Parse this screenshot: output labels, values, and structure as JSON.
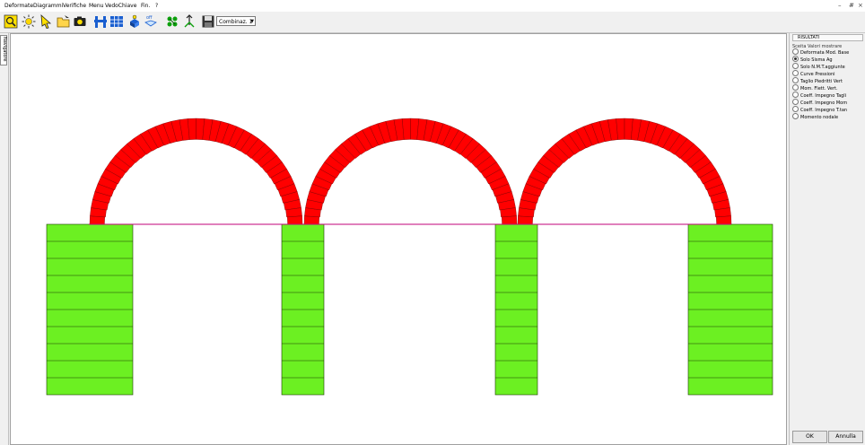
{
  "menu": {
    "items": [
      "Deformate",
      "Diagrammi",
      "Verifiche",
      "Menu",
      "VedoChiave",
      "Fin.",
      "?"
    ],
    "win_minimize": "–",
    "win_restore": "#",
    "win_close": "×"
  },
  "toolbar": {
    "icons": [
      "zoom-select-icon",
      "sun-view-icon",
      "pointer-tool-icon",
      "folder-open-icon",
      "camera-icon",
      "structure-view-icon",
      "grid-table-icon",
      "shape-3d-icon",
      "off-toggle-icon",
      "reactions-icon",
      "load-arrows-icon",
      "save-icon"
    ],
    "combo_value": "Combinaz. 1"
  },
  "left_strip": {
    "navigator_label": "Navigatore"
  },
  "right_panel": {
    "title": "RISULTATI",
    "group_label": "Sceita Valori mostrare",
    "options": [
      {
        "label": "Deformata Mod. Base",
        "selected": false
      },
      {
        "label": "Solo Sisma Ag",
        "selected": true
      },
      {
        "label": "Solo N.M.T.aggiunte",
        "selected": false
      },
      {
        "label": "Curve Pressioni",
        "selected": false
      },
      {
        "label": "Taglio Piedritti Vert",
        "selected": false
      },
      {
        "label": "Mom. Flett. Vert.",
        "selected": false
      },
      {
        "label": "Coeff. Impegno Tagli",
        "selected": false
      },
      {
        "label": "Coeff. Impegno Mom",
        "selected": false
      },
      {
        "label": "Coeff. Impegno T.tan",
        "selected": false
      },
      {
        "label": "Momento nodale",
        "selected": false
      }
    ],
    "ok_label": "OK",
    "cancel_label": "Annulla"
  },
  "drawing": {
    "pier_color": "#6cf022",
    "arch_color": "#ff0000",
    "baseline_color": "#c0007a",
    "arch_count": 3,
    "pier_count": 4
  }
}
